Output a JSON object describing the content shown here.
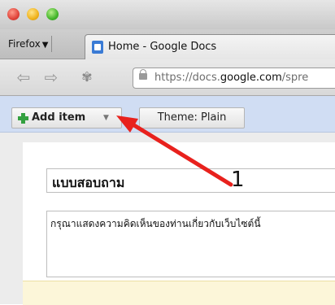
{
  "browser": {
    "menu_label": "Firefox",
    "menu_arrow": "▼",
    "tab_title": "Home - Google Docs",
    "url_prefix": "https://docs.",
    "url_domain": "google.com",
    "url_suffix": "/spre"
  },
  "toolbar": {
    "add_item_label": "Add item",
    "add_item_caret": "▼",
    "theme_label": "Theme:  Plain"
  },
  "form": {
    "title": "แบบสอบถาม",
    "description": "กรุณาแสดงความคิดเห็นของท่านเกี่ยวกับเว็บไซต์นี้"
  },
  "annotation": {
    "number": "1",
    "arrow_color": "#e8211d"
  },
  "icons": [
    "firefox-menu-arrow",
    "google-docs-icon",
    "back-arrow-icon",
    "forward-arrow-icon",
    "extension-icon",
    "lock-icon",
    "plus-icon",
    "dropdown-caret-icon",
    "red-arrow-annotation"
  ]
}
